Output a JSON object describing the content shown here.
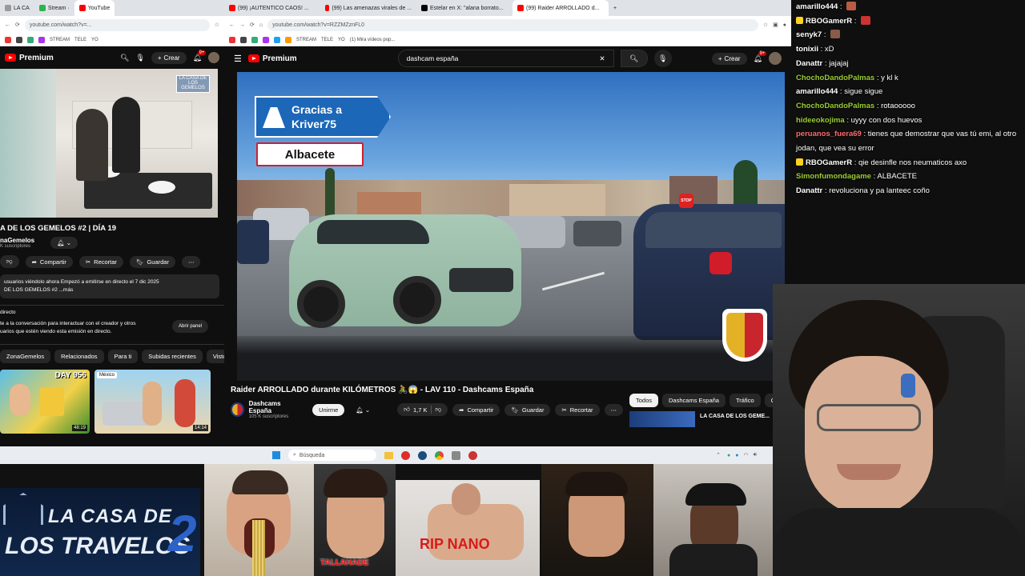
{
  "left_browser": {
    "tabs": [
      "LA CA",
      "Stream ·",
      "YouTube"
    ],
    "url": "youtube.com/watch?v=...",
    "bookmarks": [
      "STREAM",
      "TELE",
      "YO"
    ],
    "yt": {
      "brand": "Premium",
      "crear": "Crear",
      "notif": "9+"
    },
    "video_title": "A DE LOS GEMELOS #2 | DÍA 19",
    "channel": "naGemelos",
    "subs": "K suscriptores",
    "actions": {
      "share": "Compartir",
      "clip": "Recortar",
      "save": "Guardar"
    },
    "desc_line1": "usuarios viéndolo ahora  Empezó a emitirse en directo el 7 dic 2025",
    "desc_line2": "DE LOS GEMELOS #2 ...más",
    "chat_title": "directo",
    "chat_line1": "te a la conversación para interactuar con el creador y otros",
    "chat_line2": "uarios que estén viendo esta emisión en directo.",
    "open_panel": "Abrir panel",
    "chips": [
      "ZonaGemelos",
      "Relacionados",
      "Para ti",
      "Subidas recientes",
      "Visto"
    ],
    "thumb1_label": "DAY 956",
    "thumb1_dur": "48:19",
    "thumb2_badge": "México",
    "thumb2_dur": "14:14"
  },
  "main_browser": {
    "tabs": [
      "(99) ¡AUTENTICO CAOS! ...",
      "(99) Las amenazas virales de ...",
      "Estelar en X: \"alana borrato...",
      "(99) Raider ARROLLADO d..."
    ],
    "url": "youtube.com/watch?v=RZZMZznFL0",
    "bookmarks": [
      "STREAM",
      "TELE",
      "YO",
      "(1) Mira vídeos pop..."
    ],
    "yt": {
      "brand": "Premium",
      "search": "dashcam españa",
      "crear": "Crear",
      "notif": "9+"
    },
    "overlay_sign": "Gracias a Kriver75",
    "overlay_city": "Albacete",
    "stop_sign": "STOP",
    "video_title": "Raider ARROLLADO durante KILÓMETROS 🚴😱 - LAV 110 - Dashcams España",
    "channel": "Dashcams España",
    "subs": "105 K suscriptores",
    "join": "Unirme",
    "likes": "1,7 K",
    "actions": {
      "share": "Compartir",
      "save": "Guardar",
      "clip": "Recortar"
    },
    "chips": [
      "Todos",
      "Dashcams España",
      "Tráfico",
      "Cond"
    ],
    "side_video": "LA CASA DE LOS GEME..."
  },
  "chat": [
    {
      "user": "amarillo444",
      "msg": "",
      "color": "#ffffff",
      "emote": "#b85c44"
    },
    {
      "user": "RBOGamerR",
      "msg": "",
      "color": "#ffffff",
      "emote": "#cc3333",
      "badge": true
    },
    {
      "user": "senyk7",
      "msg": "",
      "color": "#ffffff",
      "emote": "#8a5a4a"
    },
    {
      "user": "tonixii",
      "msg": "xD",
      "color": "#ffffff"
    },
    {
      "user": "Danattr",
      "msg": "jajajaj",
      "color": "#ffffff"
    },
    {
      "user": "ChochoDandoPalmas",
      "msg": "y kl k",
      "color": "#9acd32"
    },
    {
      "user": "amarillo444",
      "msg": "sigue sigue",
      "color": "#ffffff"
    },
    {
      "user": "ChochoDandoPalmas",
      "msg": "rotaooooo",
      "color": "#9acd32"
    },
    {
      "user": "hideeokojima",
      "msg": "uyyy con dos huevos",
      "color": "#9acd32"
    },
    {
      "user": "peruanos_fuera69",
      "msg": "tienes que demostrar que vas tú emi, al otro",
      "color": "#ff6a6a"
    },
    {
      "user": "",
      "msg": "jodan, que vea su error",
      "color": "#ffffff"
    },
    {
      "user": "RBOGamerR",
      "msg": "qie desinfle nos neumaticos axo",
      "color": "#ffffff",
      "badge": true
    },
    {
      "user": "Simonfumondagame",
      "msg": "ALBACETE",
      "color": "#9acd32"
    },
    {
      "user": "Danattr",
      "msg": "revoluciona y pa lanteec coño",
      "color": "#ffffff"
    }
  ],
  "taskbar": {
    "search": "Búsqueda"
  },
  "strip": {
    "logo_line1": "LA CASA DE",
    "logo_line2": "LOS TRAVELOS",
    "logo_num": "2",
    "caption1": "TALLAHADE",
    "caption2": "RIP NANO"
  }
}
